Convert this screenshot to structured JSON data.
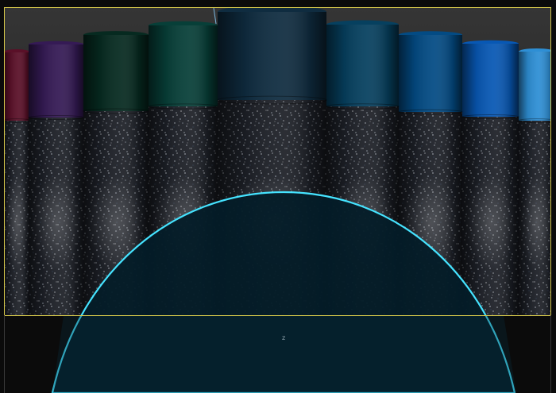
{
  "viewport": {
    "axis_label": "z",
    "frame_color": "#d4c64a",
    "selection_color": "#45e3ff",
    "selection_fill": "#041c28",
    "background_color": "#0b0b0b",
    "gradient_top": "#343434",
    "gradient_bottom": "#2a2a2a"
  },
  "cylinders": [
    {
      "name": "cylinder-crimson",
      "cap_color": "#5a1028"
    },
    {
      "name": "cylinder-purple",
      "cap_color": "#351a55"
    },
    {
      "name": "cylinder-dark-green",
      "cap_color": "#062a20"
    },
    {
      "name": "cylinder-teal",
      "cap_color": "#073f38"
    },
    {
      "name": "cylinder-slate-blue",
      "cap_color": "#0f2c40"
    },
    {
      "name": "cylinder-petrol-blue",
      "cap_color": "#06405f"
    },
    {
      "name": "cylinder-ocean-blue",
      "cap_color": "#034b84"
    },
    {
      "name": "cylinder-royal-blue",
      "cap_color": "#0858b4"
    },
    {
      "name": "cylinder-sky-blue",
      "cap_color": "#2e8fd5"
    }
  ]
}
